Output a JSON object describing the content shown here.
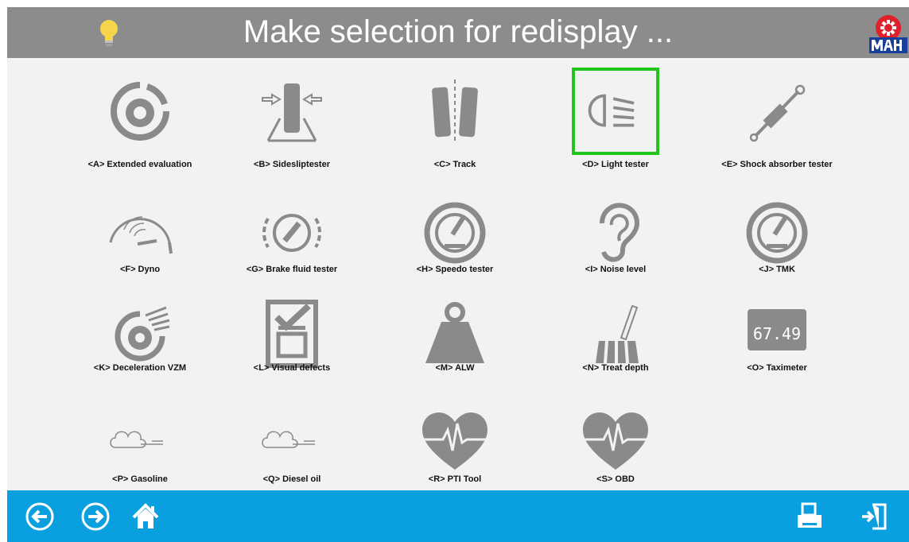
{
  "header": {
    "title": "Make selection for redisplay ..."
  },
  "tiles": [
    {
      "label": "<A> Extended evaluation",
      "icon": "brake-disc-icon"
    },
    {
      "label": "<B> Sidesliptester",
      "icon": "sideslip-icon"
    },
    {
      "label": "<C> Track",
      "icon": "track-icon"
    },
    {
      "label": "<D> Light tester",
      "icon": "headlight-icon",
      "selected": true
    },
    {
      "label": "<E> Shock absorber tester",
      "icon": "shock-absorber-icon"
    },
    {
      "label": "<F> Dyno",
      "icon": "dyno-gauge-icon"
    },
    {
      "label": "<G> Brake fluid tester",
      "icon": "brake-fluid-icon"
    },
    {
      "label": "<H> Speedo tester",
      "icon": "speedometer-icon"
    },
    {
      "label": "<I> Noise level",
      "icon": "ear-icon"
    },
    {
      "label": "<J> TMK",
      "icon": "tmk-gauge-icon"
    },
    {
      "label": "<K> Deceleration VZM",
      "icon": "deceleration-disc-icon"
    },
    {
      "label": "<L> Visual defects",
      "icon": "checklist-icon"
    },
    {
      "label": "<M> ALW",
      "icon": "weight-icon"
    },
    {
      "label": "<N> Treat depth",
      "icon": "tread-depth-icon"
    },
    {
      "label": "<O> Taximeter",
      "icon": "taximeter-icon"
    },
    {
      "label": "<P> Gasoline",
      "icon": "exhaust-cloud-icon"
    },
    {
      "label": "<Q> Diesel oil",
      "icon": "exhaust-cloud-icon"
    },
    {
      "label": "<R> PTI Tool",
      "icon": "heartbeat-icon"
    },
    {
      "label": "<S> OBD",
      "icon": "heartbeat-icon"
    }
  ],
  "taximeter_display": "67.49",
  "colors": {
    "header": "#8c8c8c",
    "footer": "#0aa0e0",
    "selected_border": "#22c61a",
    "icon_gray": "#8a8a8a"
  },
  "footer": {
    "buttons": [
      "back-icon",
      "forward-icon",
      "home-icon",
      "print-icon",
      "exit-icon"
    ]
  }
}
